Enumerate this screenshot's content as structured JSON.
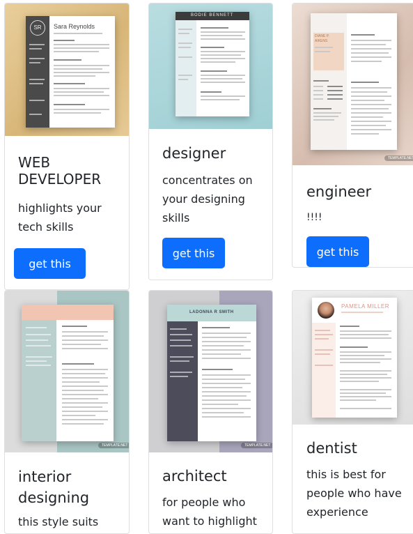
{
  "colors": {
    "primary": "#0d6efd"
  },
  "cards": [
    {
      "title": "WEB DEVELOPER",
      "desc": "highlights your tech skills",
      "button": "get this",
      "resume_name": "Sara Reynolds",
      "monogram": "SR"
    },
    {
      "title": "designer",
      "desc": "concentrates on your designing skills",
      "button": "get this",
      "resume_name": "BODIE BENNETT"
    },
    {
      "title": "engineer",
      "desc": "!!!!",
      "button": "get this",
      "resume_name": "DIANE P. AIKENS",
      "badge": "TEMPLATE.NET"
    },
    {
      "title": "interior designing",
      "desc": "this style suits",
      "badge": "TEMPLATE.NET"
    },
    {
      "title": "architect",
      "desc": "for people who want to highlight",
      "resume_name": "LADONNA R SMITH",
      "badge": "TEMPLATE.NET"
    },
    {
      "title": "dentist",
      "desc": "this is best for people who have experience",
      "resume_name": "PAMELA MILLER"
    }
  ]
}
